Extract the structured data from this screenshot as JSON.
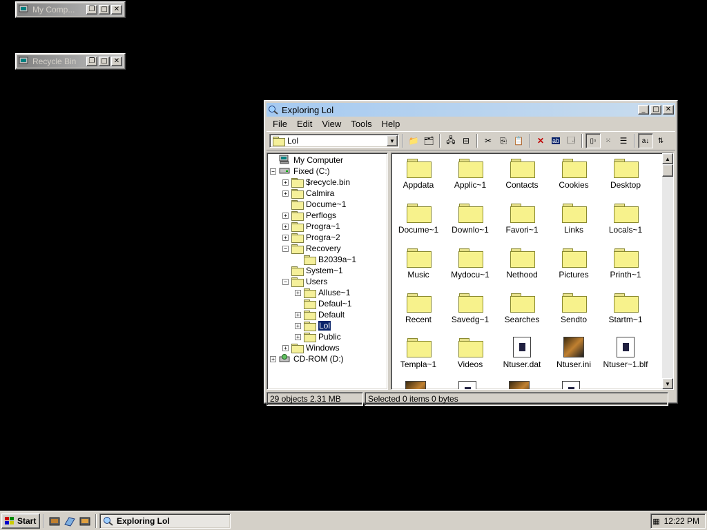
{
  "desktop": {
    "minimized": [
      {
        "title": "My Comp..."
      },
      {
        "title": "Recycle Bin"
      }
    ]
  },
  "explorer": {
    "title": "Exploring Lol",
    "menu": [
      "File",
      "Edit",
      "View",
      "Tools",
      "Help"
    ],
    "address": "Lol",
    "tree": [
      {
        "label": "My Computer"
      },
      {
        "label": "Fixed (C:)"
      },
      {
        "label": "$recycle.bin"
      },
      {
        "label": "Calmira"
      },
      {
        "label": "Docume~1"
      },
      {
        "label": "Perflogs"
      },
      {
        "label": "Progra~1"
      },
      {
        "label": "Progra~2"
      },
      {
        "label": "Recovery"
      },
      {
        "label": "B2039a~1"
      },
      {
        "label": "System~1"
      },
      {
        "label": "Users"
      },
      {
        "label": "Alluse~1"
      },
      {
        "label": "Defaul~1"
      },
      {
        "label": "Default"
      },
      {
        "label": "Lol"
      },
      {
        "label": "Public"
      },
      {
        "label": "Windows"
      },
      {
        "label": "CD-ROM (D:)"
      }
    ],
    "files": [
      {
        "label": "Appdata",
        "icon": "folder-icon"
      },
      {
        "label": "Applic~1",
        "icon": "folder-icon"
      },
      {
        "label": "Contacts",
        "icon": "folder-icon"
      },
      {
        "label": "Cookies",
        "icon": "folder-icon"
      },
      {
        "label": "Desktop",
        "icon": "folder-icon"
      },
      {
        "label": "Docume~1",
        "icon": "folder-icon"
      },
      {
        "label": "Downlo~1",
        "icon": "folder-icon"
      },
      {
        "label": "Favori~1",
        "icon": "folder-icon"
      },
      {
        "label": "Links",
        "icon": "folder-icon"
      },
      {
        "label": "Locals~1",
        "icon": "folder-icon"
      },
      {
        "label": "Music",
        "icon": "folder-icon"
      },
      {
        "label": "Mydocu~1",
        "icon": "folder-icon"
      },
      {
        "label": "Nethood",
        "icon": "folder-icon"
      },
      {
        "label": "Pictures",
        "icon": "folder-icon"
      },
      {
        "label": "Printh~1",
        "icon": "folder-icon"
      },
      {
        "label": "Recent",
        "icon": "folder-icon"
      },
      {
        "label": "Savedg~1",
        "icon": "folder-icon"
      },
      {
        "label": "Searches",
        "icon": "folder-icon"
      },
      {
        "label": "Sendto",
        "icon": "folder-icon"
      },
      {
        "label": "Startm~1",
        "icon": "folder-icon"
      },
      {
        "label": "Templa~1",
        "icon": "folder-icon"
      },
      {
        "label": "Videos",
        "icon": "folder-icon"
      },
      {
        "label": "Ntuser.dat",
        "icon": "document-icon"
      },
      {
        "label": "Ntuser.ini",
        "icon": "image-file-icon"
      },
      {
        "label": "Ntuser~1.blf",
        "icon": "document-icon"
      }
    ],
    "status": {
      "objects": "29 objects  2.31 MB",
      "selected": "Selected 0 items  0 bytes"
    }
  },
  "taskbar": {
    "start_label": "Start",
    "task_title": "Exploring Lol",
    "clock": "12:22 PM"
  }
}
